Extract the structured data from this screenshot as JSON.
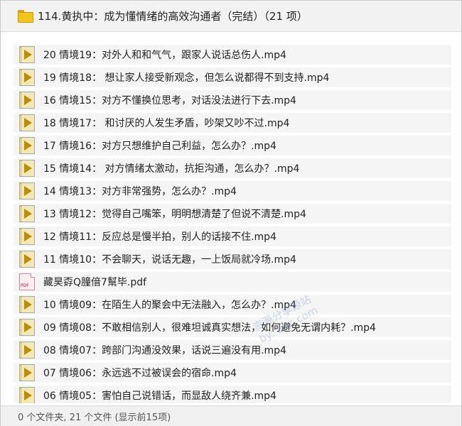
{
  "window": {
    "title": "114.黄执中：成为懂情绪的高效沟通者（完结）（21 项）"
  },
  "files": [
    {
      "name": "20 情境19：对外人和和气气，跟家人说话总伤人.mp4",
      "type": "video"
    },
    {
      "name": "19 情境18： 想让家人接受新观念，但怎么说都得不到支持.mp4",
      "type": "video"
    },
    {
      "name": "16 情境15：对方不懂换位思考，对话没法进行下去.mp4",
      "type": "video"
    },
    {
      "name": "18 情境17： 和讨厌的人发生矛盾，吵架又吵不过.mp4",
      "type": "video"
    },
    {
      "name": "17 情境16：对方只想维护自己利益，怎么办？.mp4",
      "type": "video"
    },
    {
      "name": "15 情境14： 对方情绪太激动，抗拒沟通，怎么办？.mp4",
      "type": "video"
    },
    {
      "name": "14 情境13：对方非常强势，怎么办？.mp4",
      "type": "video"
    },
    {
      "name": "13 情境12：觉得自己嘴笨，明明想清楚了但说不清楚.mp4",
      "type": "video"
    },
    {
      "name": "12 情境11：反应总是慢半拍，别人的话接不住.mp4",
      "type": "video"
    },
    {
      "name": "11 情境10：不会聊天，说话无趣，一上饭局就冷场.mp4",
      "type": "video"
    },
    {
      "name": "藏昊孬Q膧偣7幫毕.pdf",
      "type": "pdf"
    },
    {
      "name": "10 情境09：在陌生人的聚会中无法融入，怎么办？.mp4",
      "type": "video"
    },
    {
      "name": "09 情境08：不敢相信别人，很难坦诚真实想法，如何避免无谓内耗？.mp4",
      "type": "video"
    },
    {
      "name": "08 情境07：跨部门沟通没效果，话说三遍没有用.mp4",
      "type": "video"
    },
    {
      "name": "07 情境06：永远逃不过被误会的宿命.mp4",
      "type": "video"
    },
    {
      "name": "06 情境05：害怕自己说错话，而显敌人绕齐兼.mp4",
      "type": "video"
    }
  ],
  "pdf_icon_text": "PDF",
  "watermark": {
    "line1": "资源分享源站",
    "line2": "by: abc.com"
  },
  "status": {
    "text": "0 个文件夹, 21 个文件 (显示前15项)"
  }
}
